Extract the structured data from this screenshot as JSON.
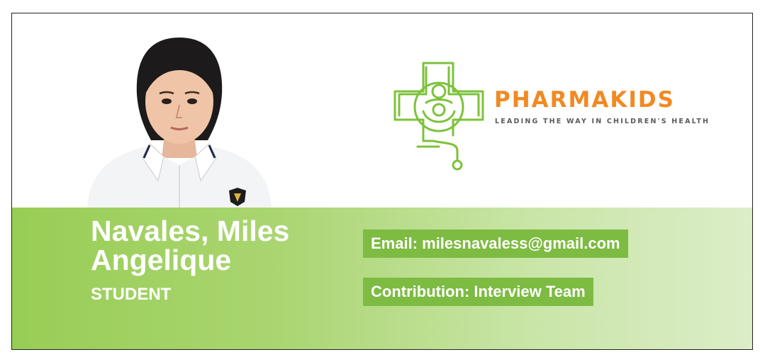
{
  "profile": {
    "name": "Navales, Miles Angelique",
    "role": "STUDENT",
    "email_line": "Email: milesnavaless@gmail.com",
    "contribution_line": "Contribution: Interview Team"
  },
  "brand": {
    "name": "PHARMAKIDS",
    "tagline": "LEADING THE WAY IN CHILDREN'S HEALTH",
    "logo_icon": "pharmacy-cross-mother-child-icon"
  },
  "colors": {
    "band_start": "#98cd55",
    "band_end": "#dcedc8",
    "pill": "#7dbb42",
    "brand_orange": "#f08a24",
    "logo_green": "#7cc23a"
  },
  "photo": {
    "icon": "student-portrait"
  }
}
